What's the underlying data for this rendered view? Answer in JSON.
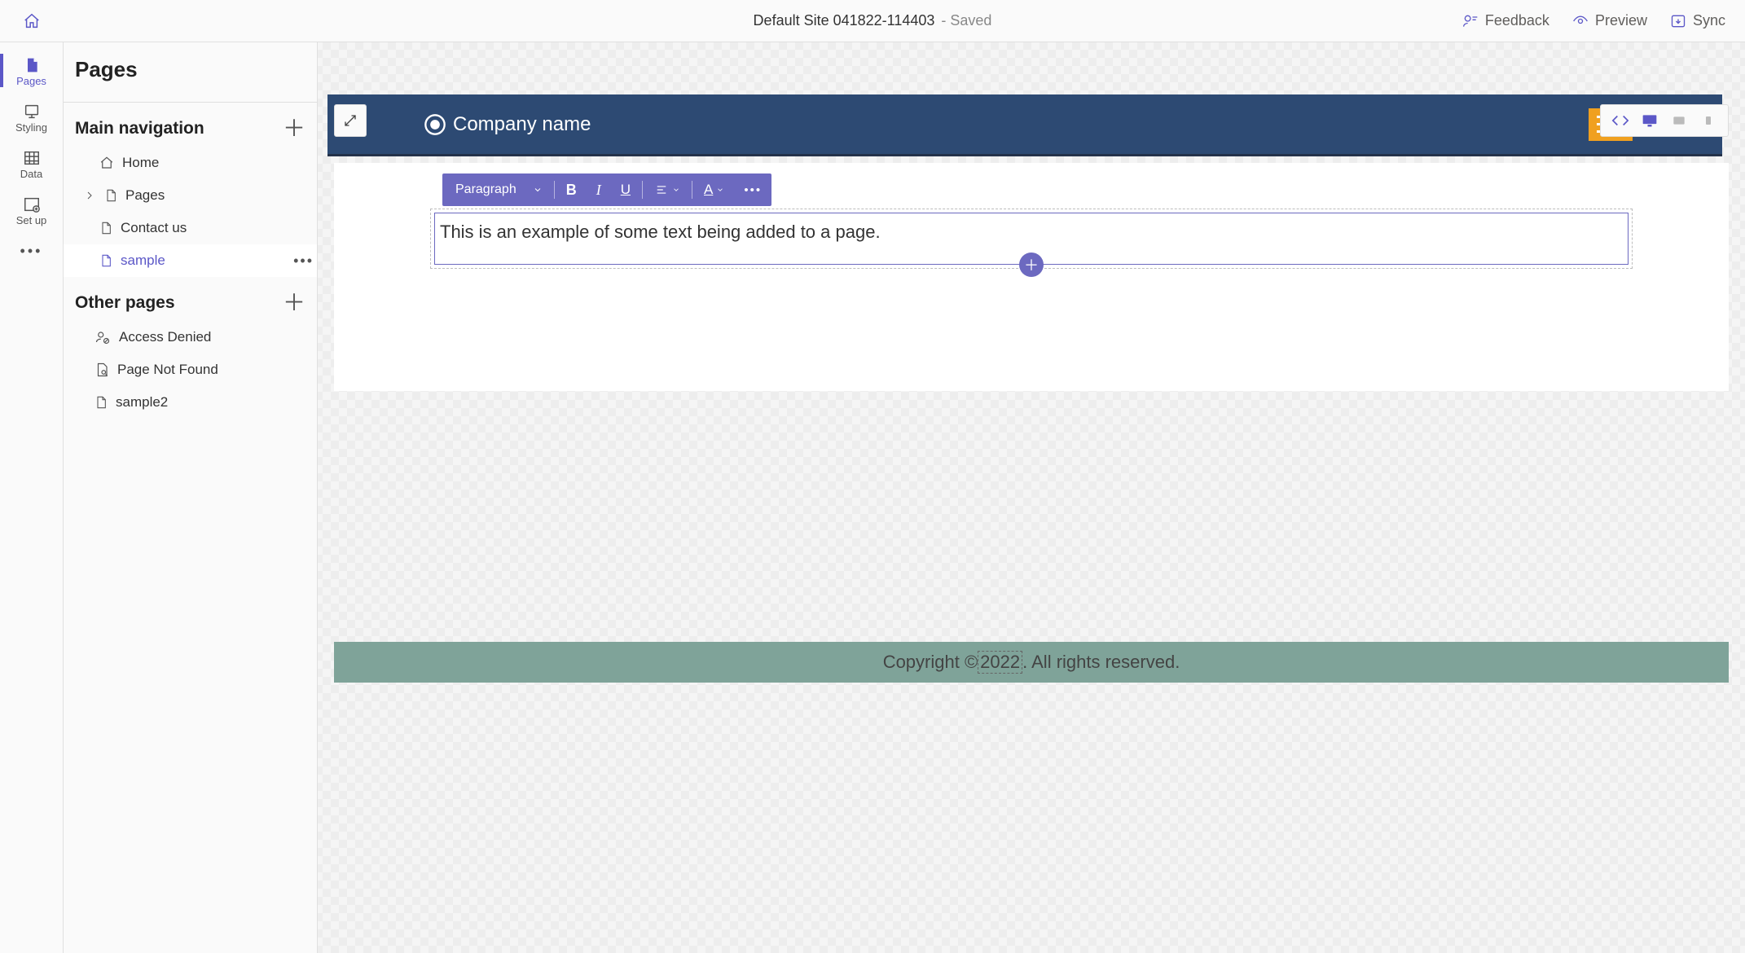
{
  "header": {
    "site_name": "Default Site 041822-114403",
    "saved_suffix": "- Saved",
    "actions": {
      "feedback": "Feedback",
      "preview": "Preview",
      "sync": "Sync"
    }
  },
  "rail": {
    "pages": "Pages",
    "styling": "Styling",
    "data": "Data",
    "setup": "Set up"
  },
  "panel": {
    "title": "Pages",
    "main_nav_label": "Main navigation",
    "other_pages_label": "Other pages",
    "nav": {
      "home": "Home",
      "pages": "Pages",
      "contact": "Contact us",
      "sample": "sample"
    },
    "other": {
      "access_denied": "Access Denied",
      "not_found": "Page Not Found",
      "sample2": "sample2"
    }
  },
  "editor": {
    "para_label": "Paragraph",
    "content_text": "This is an example of some text being added to a page."
  },
  "site": {
    "company": "Company name",
    "footer_prefix": "Copyright © ",
    "footer_year": "2022",
    "footer_suffix": ". All rights reserved."
  }
}
